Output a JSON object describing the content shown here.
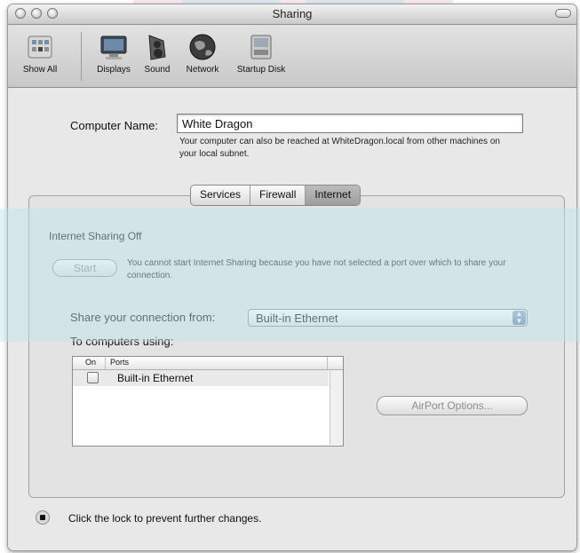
{
  "window": {
    "title": "Sharing"
  },
  "toolbar": {
    "items": [
      {
        "label": "Show All",
        "icon": "grid-icon"
      },
      {
        "label": "Displays",
        "icon": "display-icon"
      },
      {
        "label": "Sound",
        "icon": "speaker-icon"
      },
      {
        "label": "Network",
        "icon": "globe-icon"
      },
      {
        "label": "Startup Disk",
        "icon": "disk-icon"
      }
    ]
  },
  "computer_name": {
    "label": "Computer Name:",
    "value": "White Dragon",
    "hint": "Your computer can also be reached at WhiteDragon.local from other machines on your local subnet."
  },
  "tabs": [
    "Services",
    "Firewall",
    "Internet"
  ],
  "selected_tab": "Internet",
  "internet": {
    "status": "Internet Sharing Off",
    "start_button": "Start",
    "start_message": "You cannot start Internet Sharing because you have not selected a port over which to share your connection.",
    "share_from_label": "Share your connection from:",
    "share_from_value": "Built-in Ethernet",
    "to_computers_label": "To computers using:",
    "list_headers": [
      "On",
      "Ports"
    ],
    "ports": [
      {
        "on": false,
        "name": "Built-in Ethernet"
      }
    ],
    "airport_button": "AirPort Options..."
  },
  "footer": {
    "lock_text": "Click the lock to prevent further changes."
  }
}
